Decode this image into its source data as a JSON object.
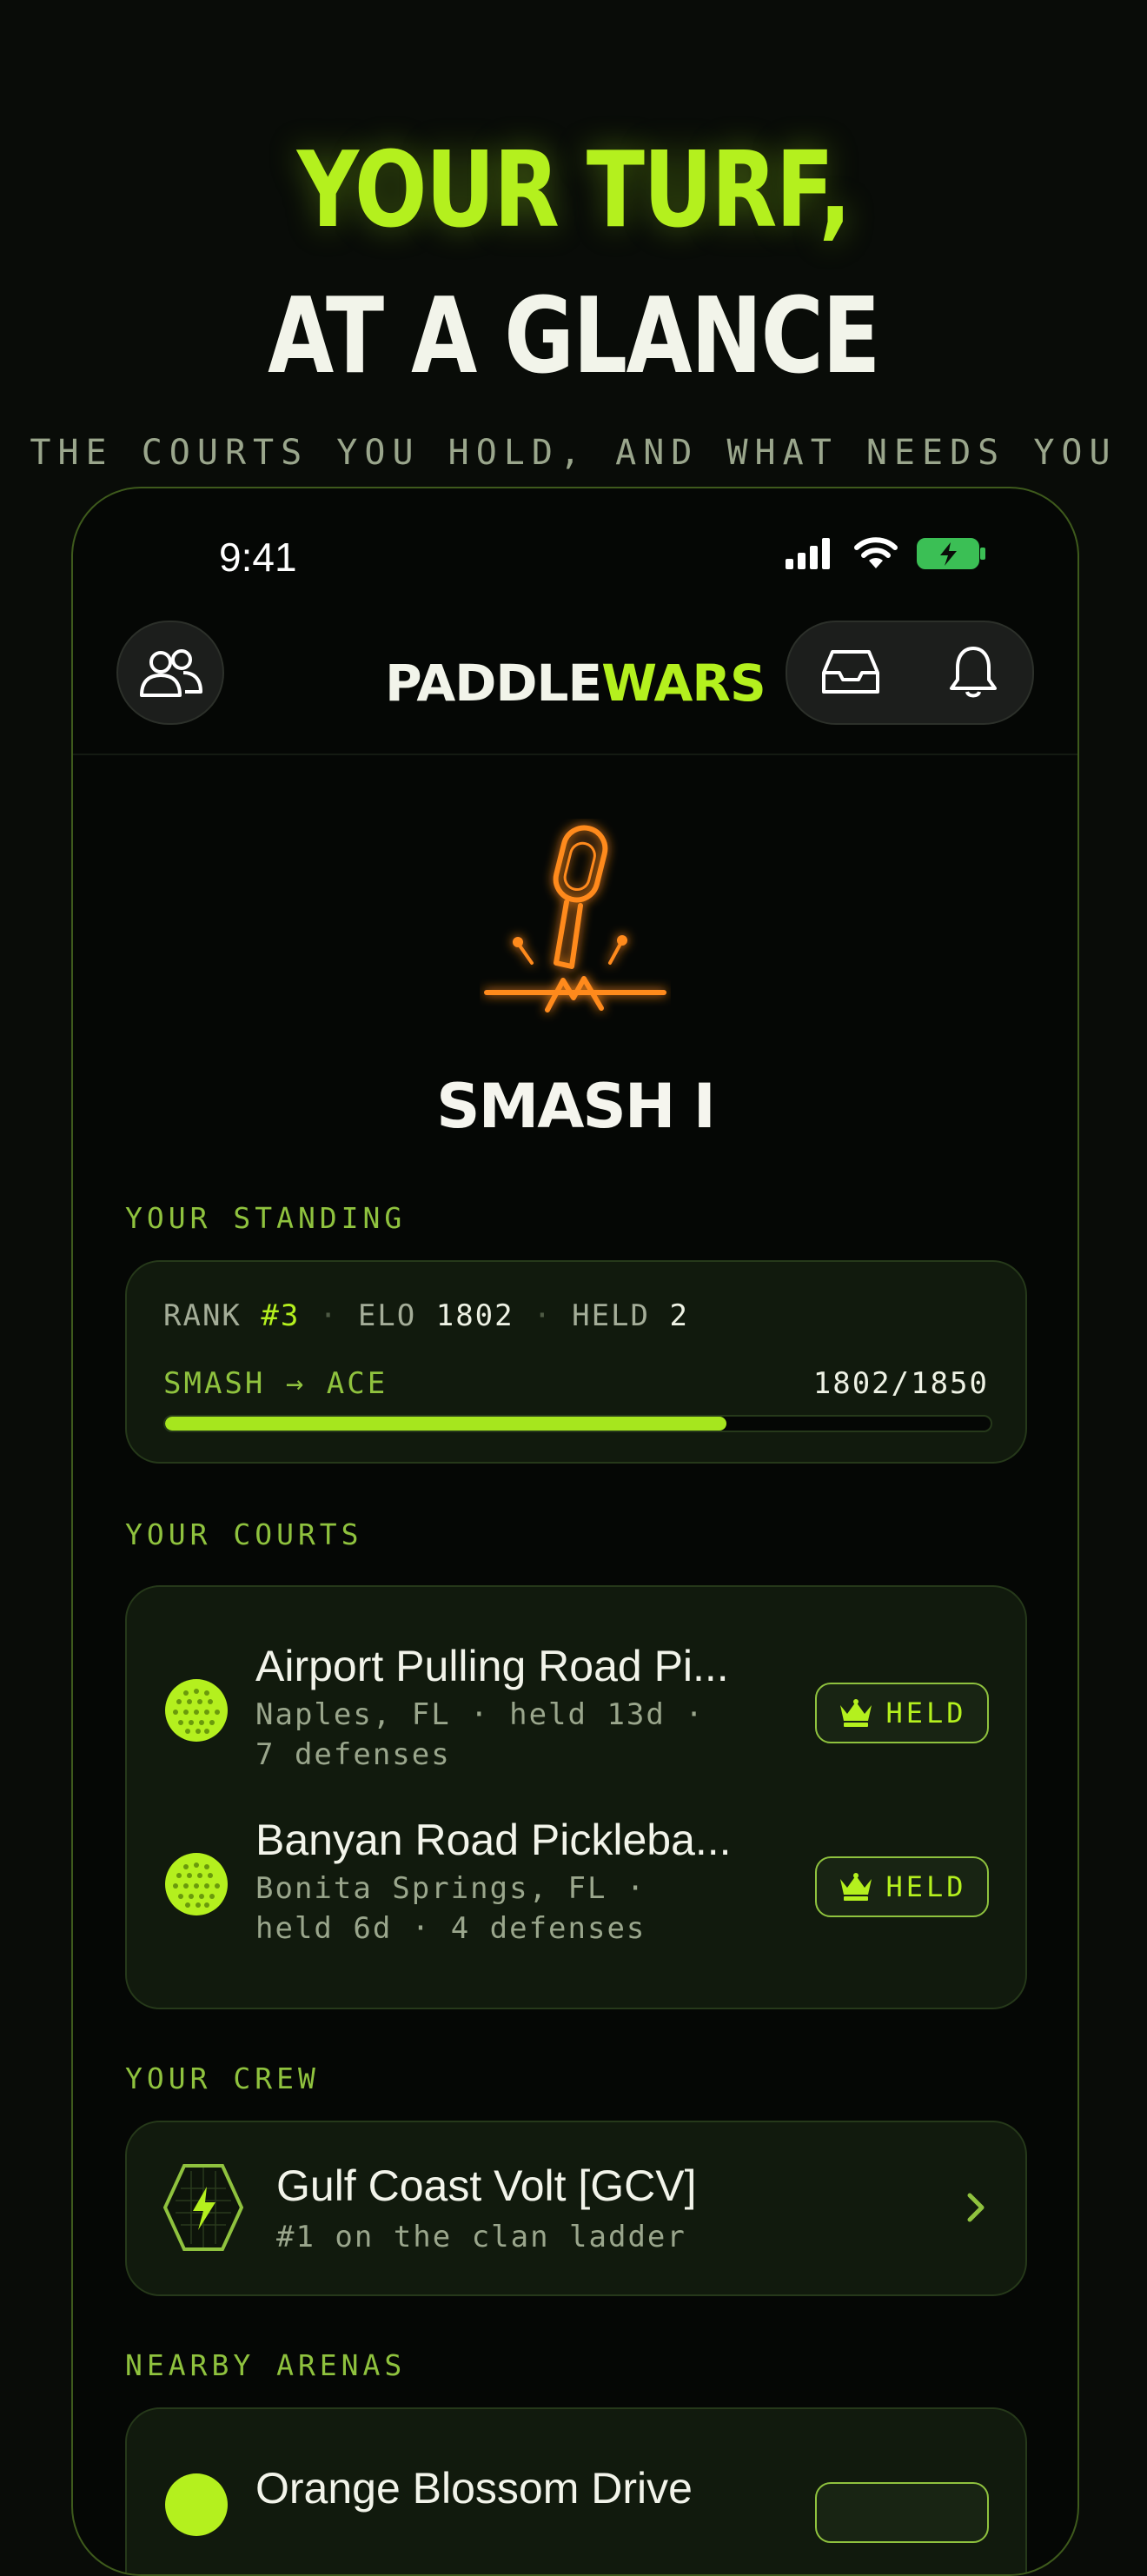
{
  "header": {
    "line1": "YOUR TURF,",
    "line2": "AT A GLANCE",
    "tagline": "THE COURTS YOU HOLD, AND WHAT NEEDS YOU"
  },
  "status_bar": {
    "time": "9:41"
  },
  "app": {
    "brand_part1": "PADDLE",
    "brand_part2": "WARS"
  },
  "profile": {
    "rank_title": "SMASH I"
  },
  "standing": {
    "label": "YOUR STANDING",
    "rank_label": "RANK",
    "rank_value": "#3",
    "elo_label": "ELO",
    "elo_value": "1802",
    "held_label": "HELD",
    "held_value": "2",
    "progress_label": "SMASH → ACE",
    "progress_text": "1802/1850",
    "progress_fraction": 0.68
  },
  "courts": {
    "label": "YOUR COURTS",
    "items": [
      {
        "name": "Airport Pulling Road Pi...",
        "meta": "Naples, FL · held 13d · 7 defenses",
        "badge": "HELD"
      },
      {
        "name": "Banyan Road Pickleba...",
        "meta": "Bonita Springs, FL · held 6d · 4 defenses",
        "badge": "HELD"
      }
    ]
  },
  "crew": {
    "label": "YOUR CREW",
    "name": "Gulf Coast Volt [GCV]",
    "subtitle": "#1 on the clan ladder"
  },
  "nearby": {
    "label": "NEARBY ARENAS",
    "first_item_partial": "Orange Blossom Drive"
  },
  "colors": {
    "accent": "#b4f01e",
    "orange": "#ff8a1e",
    "background": "#090c08"
  }
}
